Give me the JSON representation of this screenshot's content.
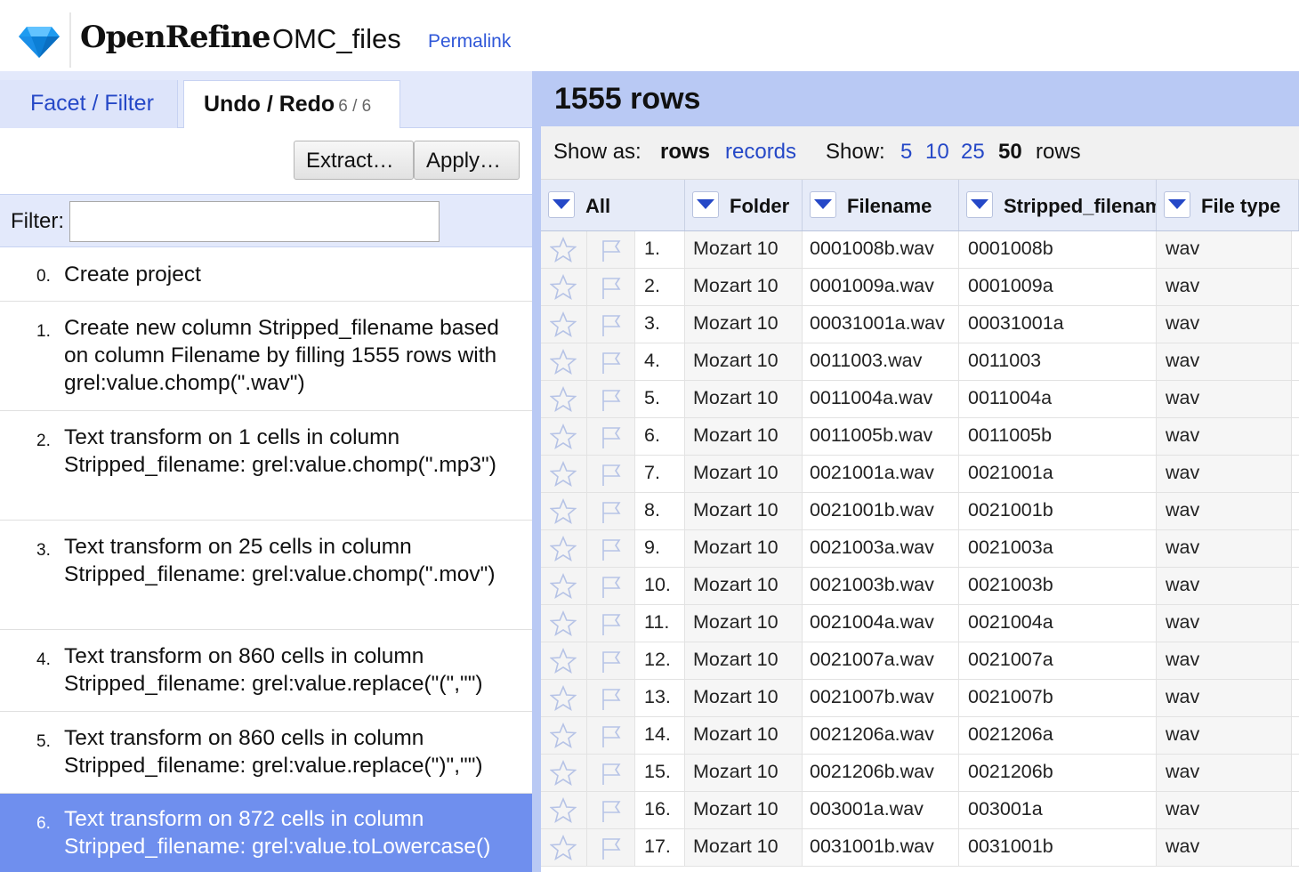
{
  "app": {
    "brand": "OpenRefine",
    "project_name": "OMC_files",
    "permalink_label": "Permalink"
  },
  "left_panel": {
    "tabs": [
      {
        "label": "Facet / Filter"
      },
      {
        "label": "Undo / Redo",
        "count": "6 / 6"
      }
    ],
    "buttons": {
      "extract": "Extract…",
      "apply": "Apply…"
    },
    "filter": {
      "label": "Filter:",
      "value": ""
    },
    "history": [
      {
        "num": "0.",
        "text": "Create project"
      },
      {
        "num": "1.",
        "text": "Create new column Stripped_filename based on column Filename by filling 1555 rows with grel:value.chomp(\".wav\")"
      },
      {
        "num": "2.",
        "text": "Text transform on 1 cells in column Stripped_filename: grel:value.chomp(\".mp3\")"
      },
      {
        "num": "3.",
        "text": "Text transform on 25 cells in column Stripped_filename: grel:value.chomp(\".mov\")"
      },
      {
        "num": "4.",
        "text": "Text transform on 860 cells in column Stripped_filename: grel:value.replace(\"(\",\"\")"
      },
      {
        "num": "5.",
        "text": "Text transform on 860 cells in column Stripped_filename: grel:value.replace(\")\",\"\")"
      },
      {
        "num": "6.",
        "text": "Text transform on 872 cells in column Stripped_filename: grel:value.toLowercase()",
        "selected": true
      }
    ]
  },
  "right_panel": {
    "row_count": "1555 rows",
    "view_bar": {
      "show_as_label": "Show as:",
      "rows_label": "rows",
      "records_label": "records",
      "show_label": "Show:",
      "page_sizes": [
        "5",
        "10",
        "25",
        "50"
      ],
      "selected_page_size": "50",
      "rows_suffix": "rows"
    },
    "columns": [
      "All",
      "Folder",
      "Filename",
      "Stripped_filenam",
      "File type"
    ],
    "rows": [
      {
        "idx": "1.",
        "folder": "Mozart 10",
        "filename": "0001008b.wav",
        "stripped": "0001008b",
        "type": "wav"
      },
      {
        "idx": "2.",
        "folder": "Mozart 10",
        "filename": "0001009a.wav",
        "stripped": "0001009a",
        "type": "wav"
      },
      {
        "idx": "3.",
        "folder": "Mozart 10",
        "filename": "00031001a.wav",
        "stripped": "00031001a",
        "type": "wav"
      },
      {
        "idx": "4.",
        "folder": "Mozart 10",
        "filename": "0011003.wav",
        "stripped": "0011003",
        "type": "wav"
      },
      {
        "idx": "5.",
        "folder": "Mozart 10",
        "filename": "0011004a.wav",
        "stripped": "0011004a",
        "type": "wav"
      },
      {
        "idx": "6.",
        "folder": "Mozart 10",
        "filename": "0011005b.wav",
        "stripped": "0011005b",
        "type": "wav"
      },
      {
        "idx": "7.",
        "folder": "Mozart 10",
        "filename": "0021001a.wav",
        "stripped": "0021001a",
        "type": "wav"
      },
      {
        "idx": "8.",
        "folder": "Mozart 10",
        "filename": "0021001b.wav",
        "stripped": "0021001b",
        "type": "wav"
      },
      {
        "idx": "9.",
        "folder": "Mozart 10",
        "filename": "0021003a.wav",
        "stripped": "0021003a",
        "type": "wav"
      },
      {
        "idx": "10.",
        "folder": "Mozart 10",
        "filename": "0021003b.wav",
        "stripped": "0021003b",
        "type": "wav"
      },
      {
        "idx": "11.",
        "folder": "Mozart 10",
        "filename": "0021004a.wav",
        "stripped": "0021004a",
        "type": "wav"
      },
      {
        "idx": "12.",
        "folder": "Mozart 10",
        "filename": "0021007a.wav",
        "stripped": "0021007a",
        "type": "wav"
      },
      {
        "idx": "13.",
        "folder": "Mozart 10",
        "filename": "0021007b.wav",
        "stripped": "0021007b",
        "type": "wav"
      },
      {
        "idx": "14.",
        "folder": "Mozart 10",
        "filename": "0021206a.wav",
        "stripped": "0021206a",
        "type": "wav"
      },
      {
        "idx": "15.",
        "folder": "Mozart 10",
        "filename": "0021206b.wav",
        "stripped": "0021206b",
        "type": "wav"
      },
      {
        "idx": "16.",
        "folder": "Mozart 10",
        "filename": "003001a.wav",
        "stripped": "003001a",
        "type": "wav"
      },
      {
        "idx": "17.",
        "folder": "Mozart 10",
        "filename": "0031001b.wav",
        "stripped": "0031001b",
        "type": "wav"
      }
    ]
  },
  "icons": {
    "logo": "diamond-logo-icon",
    "row_star": "star-icon",
    "row_flag": "flag-icon",
    "column_menu": "dropdown-arrow-icon"
  },
  "colors": {
    "accent_blue": "#2548c7",
    "selected_history": "#6f8fee",
    "panel_header": "#b9c9f4",
    "tabs_background": "#e3e9fb"
  }
}
